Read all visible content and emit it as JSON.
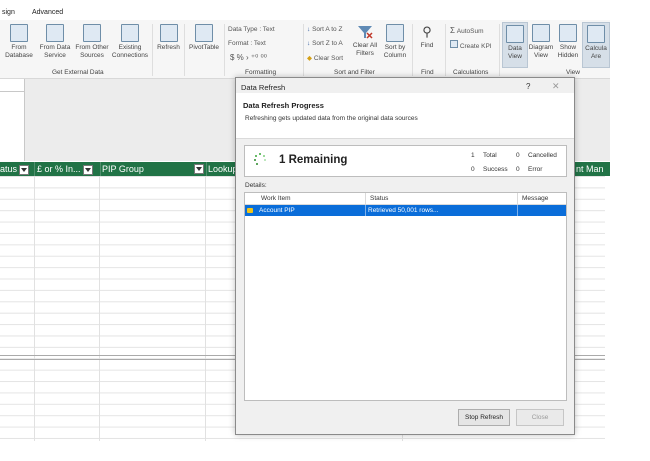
{
  "ribbon": {
    "tabs": [
      "sign",
      "Advanced"
    ],
    "buttons": {
      "from_database": "From\nDatabase",
      "from_data_service": "From Data\nService",
      "from_other_sources": "From Other\nSources",
      "existing_connections": "Existing\nConnections",
      "refresh": "Refresh",
      "pivottable": "PivotTable",
      "find": "Find",
      "data_view": "Data\nView",
      "diagram_view": "Diagram\nView",
      "show_hidden": "Show\nHidden",
      "calc_area": "Calcula\nAre"
    },
    "formatting": {
      "data_type": "Data Type : Text",
      "format": "Format : Text",
      "number_symbols": "$  %  ›  ⁺⁰ ⁰⁰"
    },
    "sort": {
      "sort_a_z": "Sort A to Z",
      "sort_z_a": "Sort Z to A",
      "clear_sort": "Clear Sort",
      "clear_all_filters": "Clear All\nFilters",
      "sort_by_column": "Sort by\nColumn"
    },
    "calc": {
      "autosum": "AutoSum",
      "create_kpi": "Create KPI"
    },
    "groups": {
      "get_external_data": "Get External Data",
      "formatting": "Formatting",
      "sort_filter": "Sort and Filter",
      "find": "Find",
      "calculations": "Calculations",
      "view": "View"
    }
  },
  "grid": {
    "columns": [
      "atus",
      "£ or % In...",
      "PIP Group",
      "Lookup",
      "nt Man"
    ]
  },
  "dialog": {
    "title": "Data Refresh",
    "help": "?",
    "close_glyph": "✕",
    "heading": "Data Refresh Progress",
    "description": "Refreshing gets updated data from the original data sources",
    "remaining": "1 Remaining",
    "stats": {
      "total_count": "1",
      "total_label": "Total",
      "cancelled_count": "0",
      "cancelled_label": "Cancelled",
      "success_count": "0",
      "success_label": "Success",
      "error_count": "0",
      "error_label": "Error"
    },
    "details_label": "Details:",
    "table": {
      "headers": [
        "Work Item",
        "Status",
        "Message"
      ],
      "rows": [
        {
          "work_item": "Account PIP",
          "status": "Retrieved 50,001 rows...",
          "message": ""
        }
      ]
    },
    "buttons": {
      "stop_refresh": "Stop Refresh",
      "close": "Close"
    }
  }
}
